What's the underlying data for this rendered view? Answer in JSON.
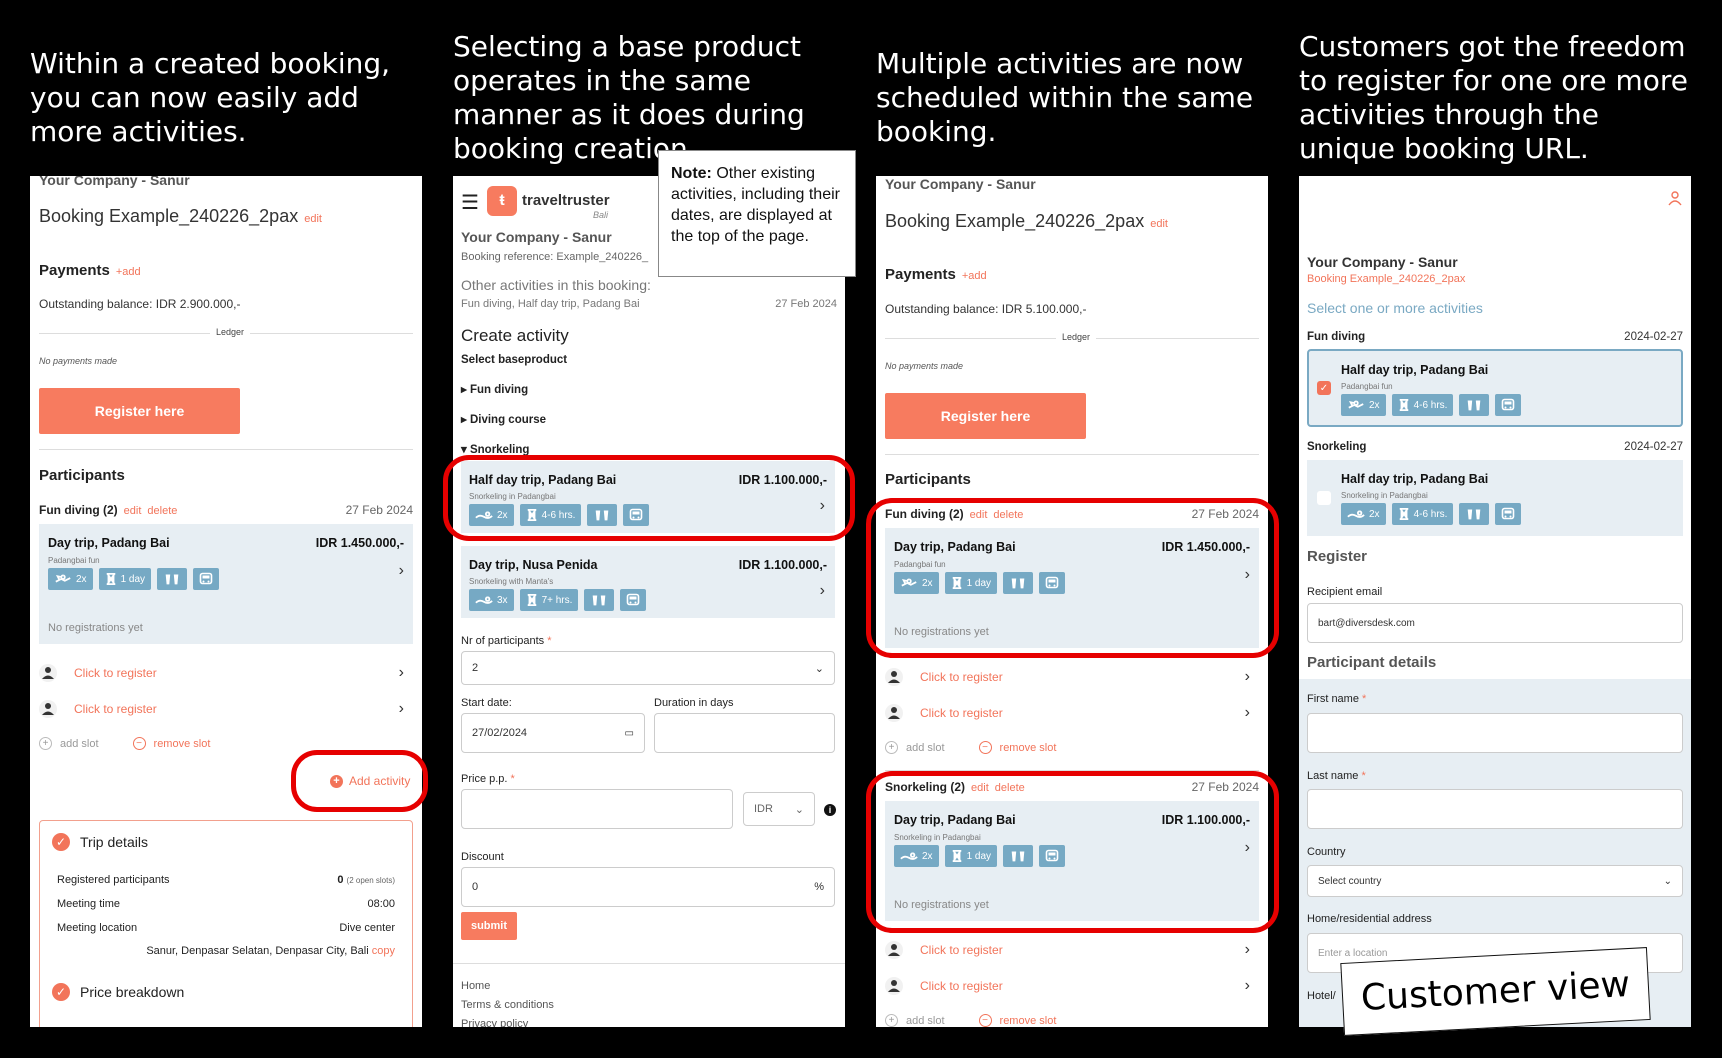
{
  "captions": [
    "Within a created booking, you can now easily add more activities.",
    "Selecting a base product operates in the same manner as it does during booking creation.",
    "Multiple activities are now scheduled within the same booking.",
    "Customers got the freedom to register for one ore more activities through the unique booking URL."
  ],
  "note": {
    "bold": "Note:",
    "text": " Other existing activities, including their dates, are displayed at the top of the page."
  },
  "customer_view_label": "Customer view",
  "panel1": {
    "company": "Your Company - Sanur",
    "booking_title": "Booking Example_240226_2pax",
    "edit": "edit",
    "payments": "Payments",
    "add": "+add",
    "outstanding": "Outstanding balance: IDR 2.900.000,-",
    "ledger": "Ledger",
    "no_payments": "No payments made",
    "register_btn": "Register here",
    "participants": "Participants",
    "activity_label": "Fun diving (2)",
    "delete": "delete",
    "date": "27 Feb 2024",
    "card_title": "Day trip, Padang Bai",
    "card_price": "IDR 1.450.000,-",
    "card_sub": "Padangbai fun",
    "badge_count": "2x",
    "badge_dur": "1 day",
    "no_reg": "No registrations yet",
    "click_register": "Click to register",
    "add_slot": "add slot",
    "remove_slot": "remove slot",
    "add_activity": "Add activity",
    "trip_details": "Trip details",
    "registered": "Registered participants",
    "registered_val": "0",
    "open_slots": "(2 open slots)",
    "meeting_time": "Meeting time",
    "meeting_time_val": "08:00",
    "meeting_loc": "Meeting location",
    "meeting_loc_val": "Dive center",
    "address": "Sanur, Denpasar Selatan, Denpasar City, Bali",
    "copy": "copy",
    "price_breakdown": "Price breakdown"
  },
  "panel2": {
    "logo": "traveltruster",
    "logo_sub": "Bali",
    "company": "Your Company - Sanur",
    "ref": "Booking reference: Example_240226_",
    "other": "Other activities in this booking:",
    "other_list": "Fun diving, Half day trip, Padang Bai",
    "other_date": "27 Feb 2024",
    "create": "Create activity",
    "select_base": "Select baseproduct",
    "cat1": "Fun diving",
    "cat2": "Diving course",
    "cat3": "Snorkeling",
    "p1_title": "Half day trip, Padang Bai",
    "p1_price": "IDR 1.100.000,-",
    "p1_sub": "Snorkeling in Padangbai",
    "p1_count": "2x",
    "p1_dur": "4-6 hrs.",
    "p2_title": "Day trip, Nusa Penida",
    "p2_price": "IDR 1.100.000,-",
    "p2_sub": "Snorkeling with Manta's",
    "p2_count": "3x",
    "p2_dur": "7+ hrs.",
    "nr_participants": "Nr of participants",
    "req": "*",
    "nr_value": "2",
    "start_date": "Start date:",
    "start_value": "27/02/2024",
    "duration": "Duration in days",
    "price_pp": "Price p.p.",
    "currency": "IDR",
    "discount": "Discount",
    "discount_value": "0",
    "percent": "%",
    "submit": "submit",
    "footer1": "Home",
    "footer2": "Terms & conditions",
    "footer3": "Privacy policy"
  },
  "panel3": {
    "company": "Your Company - Sanur",
    "booking_title": "Booking Example_240226_2pax",
    "edit": "edit",
    "payments": "Payments",
    "add": "+add",
    "outstanding": "Outstanding balance: IDR 5.100.000,-",
    "ledger": "Ledger",
    "no_payments": "No payments made",
    "register_btn": "Register here",
    "participants": "Participants",
    "act1_label": "Fun diving (2)",
    "act2_label": "Snorkeling (2)",
    "delete": "delete",
    "date": "27 Feb 2024",
    "c1_title": "Day trip, Padang Bai",
    "c1_price": "IDR 1.450.000,-",
    "c1_sub": "Padangbai fun",
    "c2_title": "Day trip, Padang Bai",
    "c2_price": "IDR 1.100.000,-",
    "c2_sub": "Snorkeling in Padangbai",
    "badge_count": "2x",
    "badge_dur": "1 day",
    "no_reg": "No registrations yet",
    "click_register": "Click to register",
    "add_slot": "add slot",
    "remove_slot": "remove slot"
  },
  "panel4": {
    "company": "Your Company - Sanur",
    "booking": "Booking Example_240226_2pax",
    "select": "Select one or more activities",
    "sec1": "Fun diving",
    "sec1_date": "2024-02-27",
    "sec2": "Snorkeling",
    "sec2_date": "2024-02-27",
    "c_title": "Half day trip, Padang Bai",
    "c1_sub": "Padangbai fun",
    "c2_sub": "Snorkeling in Padangbai",
    "badge_count": "2x",
    "badge_dur": "4-6 hrs.",
    "register": "Register",
    "recipient": "Recipient email",
    "email": "bart@diversdesk.com",
    "participant_details": "Participant details",
    "first": "First name",
    "last": "Last name",
    "req": "*",
    "country": "Country",
    "country_sel": "Select country",
    "address": "Home/residential address",
    "address_ph": "Enter a location",
    "hotel": "Hotel/"
  }
}
